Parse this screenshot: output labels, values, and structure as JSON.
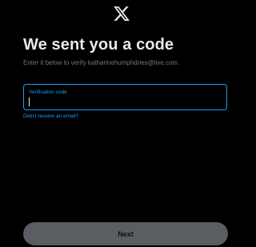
{
  "brand": {
    "logo_icon": "x-logo-icon"
  },
  "heading": {
    "title": "We sent you a code",
    "subtitle": "Enter it below to verify katharinehumphdries@live.com."
  },
  "code_field": {
    "label": "Verification code",
    "value": ""
  },
  "resend_link": "Didn't receive an email?",
  "actions": {
    "next_label": "Next"
  },
  "colors": {
    "background": "#000000",
    "accent": "#1d9bf0",
    "text_primary": "#e7e9ea",
    "text_secondary": "#71767b",
    "button_disabled": "#5a5d61"
  }
}
